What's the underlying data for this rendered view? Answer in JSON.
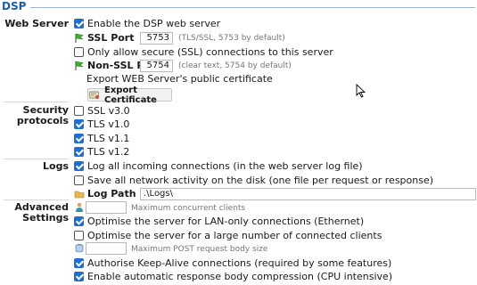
{
  "section_title": "DSP",
  "labels": {
    "web_server": "Web Server",
    "security_line1": "Security",
    "security_line2": "protocols",
    "logs": "Logs",
    "advanced_line1": "Advanced",
    "advanced_line2": "Settings"
  },
  "web_server": {
    "enable": {
      "label": "Enable the DSP web server",
      "checked": true
    },
    "ssl_port": {
      "label": "SSL Port",
      "value": "5753",
      "hint": "(TLS/SSL, 5753 by default)"
    },
    "only_secure": {
      "label": "Only allow secure (SSL) connections to this server",
      "checked": false
    },
    "non_ssl_port": {
      "label": "Non-SSL Port",
      "value": "5754",
      "hint": "(clear text, 5754 by default)"
    },
    "export_text": "Export WEB Server's public certificate",
    "export_button": "Export Certificate"
  },
  "security": [
    {
      "label": "SSL v3.0",
      "checked": false
    },
    {
      "label": "TLS v1.0",
      "checked": true
    },
    {
      "label": "TLS v1.1",
      "checked": true
    },
    {
      "label": "TLS v1.2",
      "checked": true
    }
  ],
  "logs": {
    "log_all": {
      "label": "Log all incoming connections (in the web server log file)",
      "checked": true
    },
    "save_all": {
      "label": "Save all network activity on the disk (one file per request or response)",
      "checked": false
    },
    "log_path": {
      "label": "Log Path",
      "value": ".\\Logs\\"
    }
  },
  "advanced": {
    "max_clients": {
      "value": "",
      "hint": "Maximum concurrent clients"
    },
    "lan_only": {
      "label": "Optimise the server for LAN-only connections (Ethernet)",
      "checked": true
    },
    "large_number": {
      "label": "Optimise the server for a large number of connected clients",
      "checked": false
    },
    "max_post": {
      "value": "",
      "hint": "Maximum POST request body size"
    },
    "keep_alive": {
      "label": "Authorise Keep-Alive connections (required by some features)",
      "checked": true
    },
    "compression": {
      "label": "Enable automatic response body compression (CPU intensive)",
      "checked": true
    }
  },
  "icons": {
    "port": "flag-icon",
    "clients": "person-icon",
    "body_size": "database-icon",
    "certificate": "certificate-icon",
    "folder": "folder-icon"
  },
  "colors": {
    "accent": "#1e6fd0",
    "title": "#1f5fa8"
  }
}
